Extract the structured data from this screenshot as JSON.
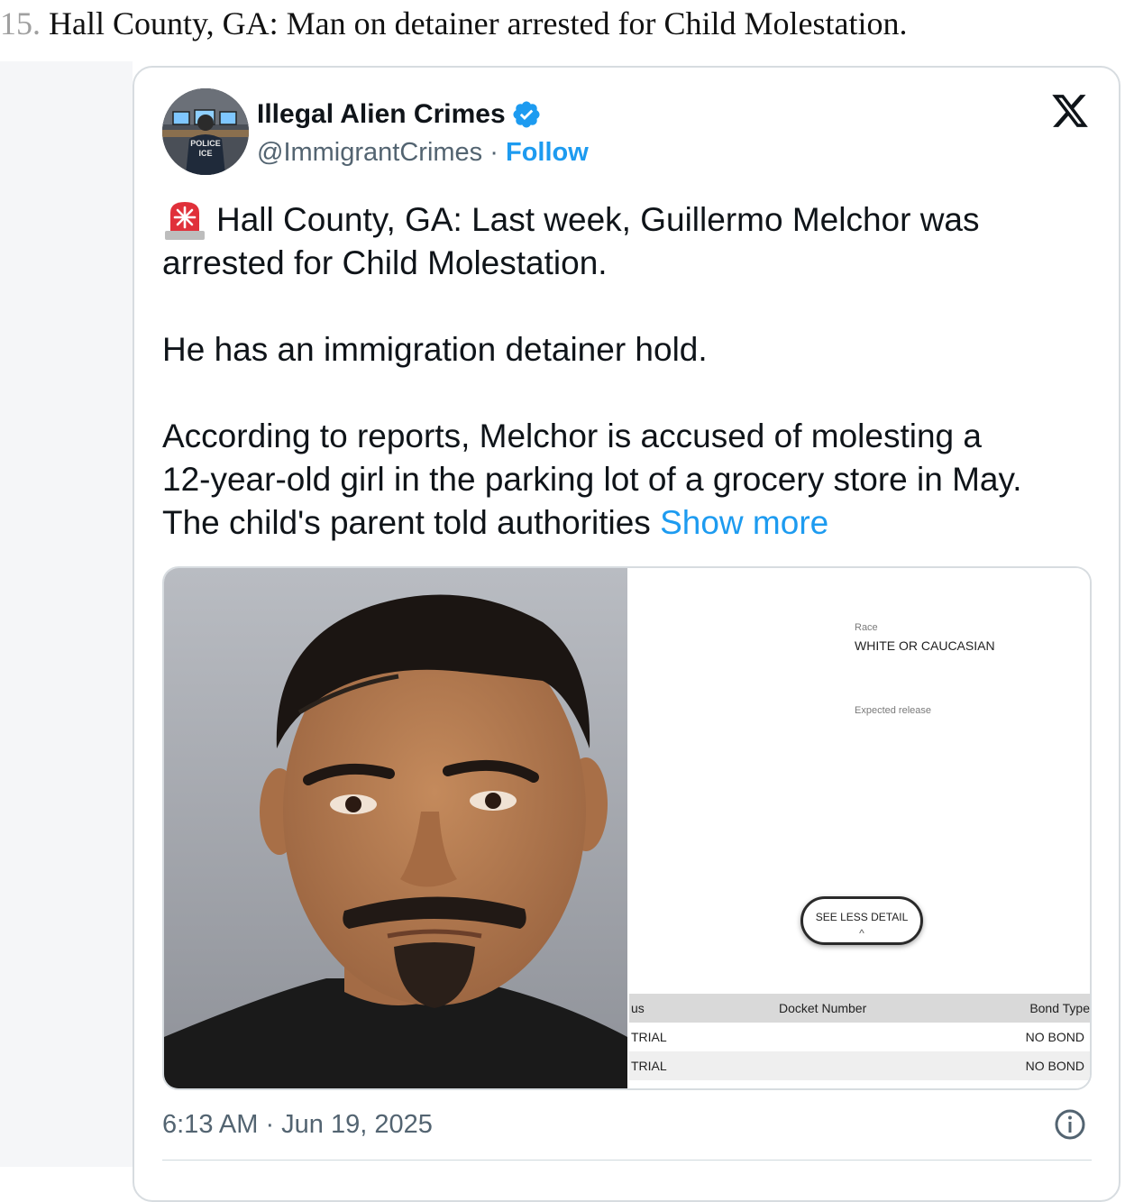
{
  "article": {
    "item_number": "15.",
    "heading": "Hall County, GA: Man on detainer arrested for Child Molestation."
  },
  "tweet": {
    "author_name": "Illegal Alien Crimes",
    "handle": "@ImmigrantCrimes",
    "separator": "·",
    "follow_label": "Follow",
    "text_line1": "Hall County, GA: Last week, Guillermo Melchor was",
    "text_line2": "arrested for Child Molestation.",
    "text_line3": "He has an immigration detainer hold.",
    "text_line4": "According to reports, Melchor is accused of molesting a",
    "text_line5": "12-year-old girl in the parking lot of a grocery store in May.",
    "text_line6": "The child's parent told authorities",
    "show_more": "Show more",
    "timestamp": "6:13 AM · Jun 19, 2025",
    "avatar_text1": "POLICE",
    "avatar_text2": "ICE"
  },
  "record": {
    "race_label": "Race",
    "race_value": "WHITE OR CAUCASIAN",
    "release_label": "Expected release",
    "see_less_label": "SEE LESS DETAIL",
    "see_less_chevron": "^",
    "columns": [
      "us",
      "Docket Number",
      "Bond Type"
    ],
    "rows": [
      {
        "status": "TRIAL",
        "docket": "",
        "bond": "NO BOND"
      },
      {
        "status": "TRIAL",
        "docket": "",
        "bond": "NO BOND"
      }
    ]
  },
  "icons": [
    "verified-badge-icon",
    "x-logo-icon",
    "siren-icon",
    "info-icon"
  ],
  "colors": {
    "accent": "#1d9bf0",
    "text": "#0f1419",
    "muted": "#536471",
    "border": "#d7dce0"
  }
}
